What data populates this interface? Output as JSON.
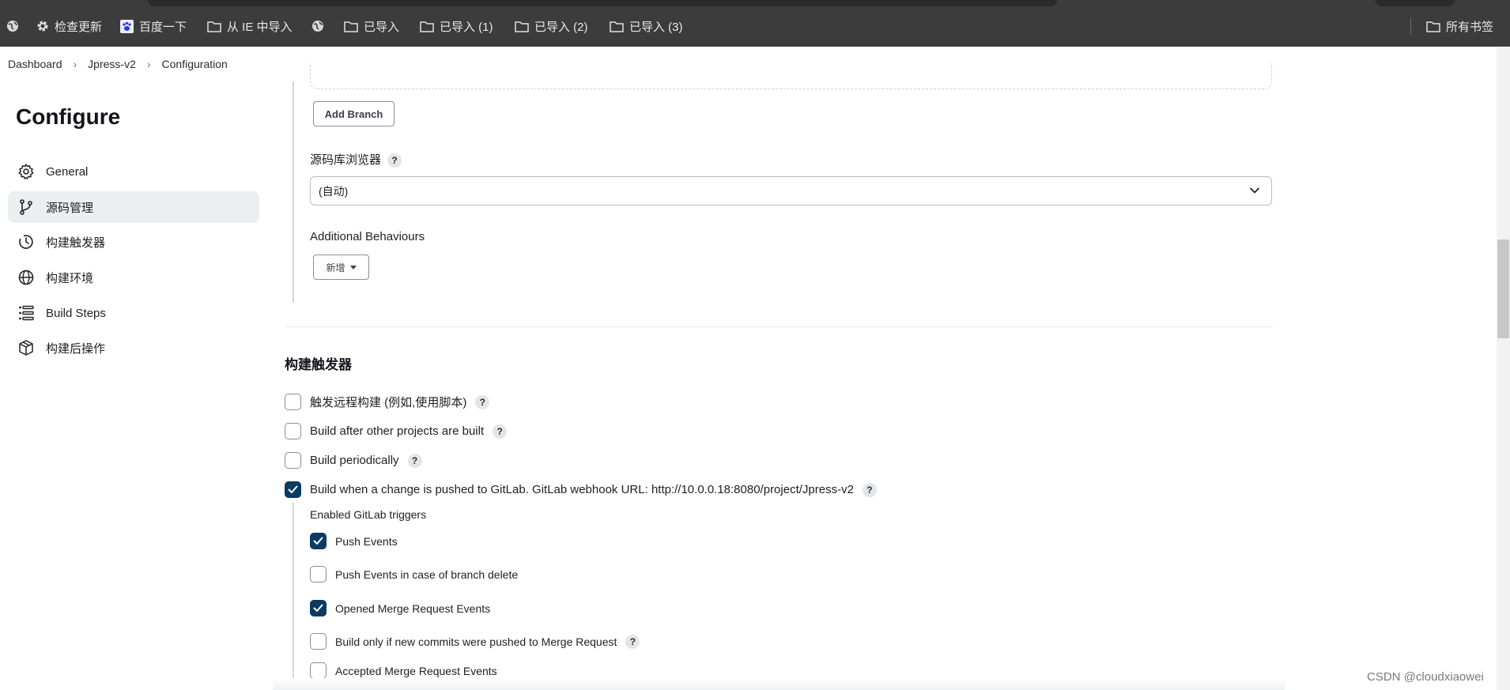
{
  "bookmarks": {
    "items": [
      {
        "label": "",
        "icon": "globe-icon"
      },
      {
        "label": "检查更新",
        "icon": "gear-icon"
      },
      {
        "label": "百度一下",
        "icon": "baidu-paw-icon"
      },
      {
        "label": "从 IE 中导入",
        "icon": "folder-icon"
      },
      {
        "label": "",
        "icon": "globe-icon"
      },
      {
        "label": "已导入",
        "icon": "folder-icon"
      },
      {
        "label": "已导入 (1)",
        "icon": "folder-icon"
      },
      {
        "label": "已导入 (2)",
        "icon": "folder-icon"
      },
      {
        "label": "已导入 (3)",
        "icon": "folder-icon"
      }
    ],
    "all_bookmarks": "所有书签"
  },
  "breadcrumb": [
    "Dashboard",
    "Jpress-v2",
    "Configuration"
  ],
  "sidebar": {
    "title": "Configure",
    "items": [
      {
        "label": "General",
        "icon": "gear-icon",
        "active": false
      },
      {
        "label": "源码管理",
        "icon": "git-branch-icon",
        "active": true
      },
      {
        "label": "构建触发器",
        "icon": "clock-icon",
        "active": false
      },
      {
        "label": "构建环境",
        "icon": "globe-icon",
        "active": false
      },
      {
        "label": "Build Steps",
        "icon": "list-icon",
        "active": false
      },
      {
        "label": "构建后操作",
        "icon": "cube-icon",
        "active": false
      }
    ]
  },
  "scm": {
    "add_branch": "Add Branch",
    "repo_browser_label": "源码库浏览器",
    "repo_browser_value": "(自动)",
    "additional_behaviours": "Additional Behaviours",
    "add_new": "新增"
  },
  "triggers": {
    "title": "构建触发器",
    "items": [
      {
        "label": "触发远程构建 (例如,使用脚本)",
        "checked": false,
        "help": true
      },
      {
        "label": "Build after other projects are built",
        "checked": false,
        "help": true
      },
      {
        "label": "Build periodically",
        "checked": false,
        "help": true
      },
      {
        "label": "Build when a change is pushed to GitLab. GitLab webhook URL: http://10.0.0.18:8080/project/Jpress-v2",
        "checked": true,
        "help": true
      }
    ],
    "gitlab_label": "Enabled GitLab triggers",
    "gitlab_items": [
      {
        "label": "Push Events",
        "checked": true,
        "help": false
      },
      {
        "label": "Push Events in case of branch delete",
        "checked": false,
        "help": false
      },
      {
        "label": "Opened Merge Request Events",
        "checked": true,
        "help": false
      },
      {
        "label": "Build only if new commits were pushed to Merge Request",
        "checked": false,
        "help": true
      },
      {
        "label": "Accepted Merge Request Events",
        "checked": false,
        "help": false
      }
    ]
  },
  "watermark": "CSDN @cloudxiaowei",
  "help_glyph": "?",
  "colors": {
    "checkbox_checked": "#0b3a63",
    "bookmark_bar": "#3c3c3c",
    "sidebar_active": "#eceef2"
  }
}
